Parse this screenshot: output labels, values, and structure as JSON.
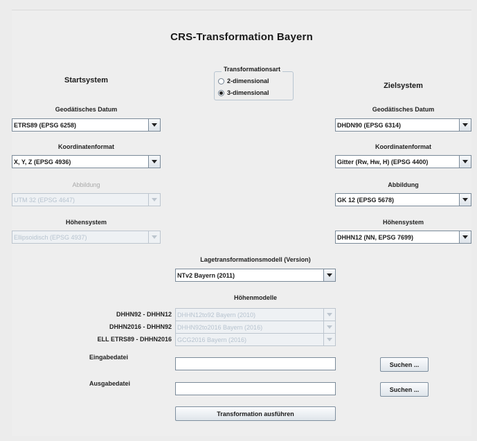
{
  "title": "CRS-Transformation Bayern",
  "start": {
    "heading": "Startsystem",
    "datum_label": "Geodätisches Datum",
    "datum_value": "ETRS89 (EPSG 6258)",
    "format_label": "Koordinatenformat",
    "format_value": "X, Y, Z (EPSG 4936)",
    "projection_label": "Abbildung",
    "projection_value": "UTM 32 (EPSG 4647)",
    "height_label": "Höhensystem",
    "height_value": "Ellipsoidisch (EPSG 4937)"
  },
  "target": {
    "heading": "Zielsystem",
    "datum_label": "Geodätisches Datum",
    "datum_value": "DHDN90 (EPSG 6314)",
    "format_label": "Koordinatenformat",
    "format_value": "Gitter (Rw, Hw, H) (EPSG 4400)",
    "projection_label": "Abbildung",
    "projection_value": "GK 12 (EPSG 5678)",
    "height_label": "Höhensystem",
    "height_value": "DHHN12 (NN, EPSG 7699)"
  },
  "transformation_type": {
    "title": "Transformationsart",
    "option_2d": "2-dimensional",
    "option_3d": "3-dimensional",
    "selected": "3-dimensional"
  },
  "lage_model": {
    "label": "Lagetransformationsmodell (Version)",
    "value": "NTv2 Bayern (2011)"
  },
  "hoehen": {
    "label": "Höhenmodelle",
    "rows": [
      {
        "label": "DHHN92 - DHHN12",
        "value": "DHHN12to92 Bayern (2010)"
      },
      {
        "label": "DHHN2016 - DHHN92",
        "value": "DHHN92to2016 Bayern (2016)"
      },
      {
        "label": "ELL ETRS89 - DHHN2016",
        "value": "GCG2016 Bayern (2016)"
      }
    ]
  },
  "input_file": {
    "label": "Eingabedatei",
    "value": "",
    "button": "Suchen ..."
  },
  "output_file": {
    "label": "Ausgabedatei",
    "value": "",
    "button": "Suchen ..."
  },
  "run_button": "Transformation ausführen"
}
